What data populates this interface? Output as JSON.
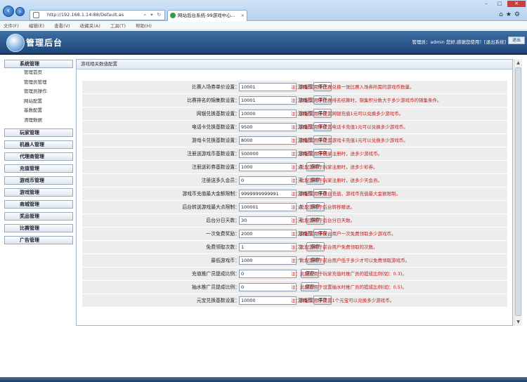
{
  "browser": {
    "url": "http://192.168.1.14:88/Default.as",
    "tab_title": "网站后台系统-99游戏中心...",
    "menu": [
      "文件(F)",
      "编辑(E)",
      "查看(V)",
      "收藏夹(A)",
      "工具(T)",
      "帮助(H)"
    ]
  },
  "header": {
    "title": "管理后台",
    "user_info": "管理员：admin 您好,感谢您使用！[退出系统]",
    "logout_label": "退出"
  },
  "sidebar": {
    "groups": [
      {
        "label": "系统管理",
        "items": [
          "管理首页",
          "管理员管理",
          "管理员操作",
          "网站配置",
          "基数配置",
          "清理数据"
        ]
      },
      {
        "label": "玩家管理",
        "items": []
      },
      {
        "label": "机器人管理",
        "items": []
      },
      {
        "label": "代理商管理",
        "items": []
      },
      {
        "label": "充值管理",
        "items": []
      },
      {
        "label": "游戏币管理",
        "items": []
      },
      {
        "label": "游戏管理",
        "items": []
      },
      {
        "label": "商城管理",
        "items": []
      },
      {
        "label": "奖品管理",
        "items": []
      },
      {
        "label": "比赛管理",
        "items": []
      },
      {
        "label": "广告管理",
        "items": []
      }
    ]
  },
  "panel": {
    "title": "游戏相关数值配置",
    "save_label": "保存",
    "rows": [
      {
        "label": "比赛入场券单价设置：",
        "value": "10001",
        "unit": "游戏币",
        "note": "注：此配置用于比赛兑换一张比赛入场券所需的游戏币数量。"
      },
      {
        "label": "比赛排名的锦集数设置：",
        "value": "10001",
        "unit": "游戏币",
        "note": "注：此配置用于比赛排名结算时，锦集积分数大于多少游戏币的锦集条件。"
      },
      {
        "label": "网银兑换基数设置：",
        "value": "10000",
        "unit": "游戏币",
        "note": "注：此配置用于设置网银充值1元可以兑换多少游戏币。"
      },
      {
        "label": "电话卡兑换基数设置：",
        "value": "9500",
        "unit": "游戏币",
        "note": "注：此配置用于设置电话卡充值1元可以兑换多少游戏币。"
      },
      {
        "label": "游戏卡兑换基数设置：",
        "value": "8000",
        "unit": "游戏币",
        "note": "注：此配置用于设置游戏卡充值1元可以兑换多少游戏币。"
      },
      {
        "label": "注册送游戏币基数设置：",
        "value": "500000",
        "unit": "游戏币",
        "note": "注：此配置用于玩家注册时，送多少游戏币。"
      },
      {
        "label": "注册送彩券基数设置：",
        "value": "1000",
        "unit": "点",
        "note": "注：此配置用于玩家注册时，送多少彩券。"
      },
      {
        "label": "注册送多久会员：",
        "value": "0",
        "unit": "天",
        "note": "注：此配置用于玩家注册时，送多少天会员。"
      },
      {
        "label": "游戏币充值最大金额限制：",
        "value": "9999999999991",
        "unit": "游戏币",
        "note": "注：此配置用于后台充值，游戏币充值最大金额限制。"
      },
      {
        "label": "后台转送游戏最大点限制：",
        "value": "100001",
        "unit": "点",
        "note": "注：此配置用于后台转移赠送。"
      },
      {
        "label": "后台分日天数：",
        "value": "30",
        "unit": "天",
        "note": "注：此配置用于后台分日天数。"
      },
      {
        "label": "一次免费奖励：",
        "value": "2000",
        "unit": "游戏币",
        "note": "注：此配置用于前台用户一次免费领取多少游戏币。"
      },
      {
        "label": "免费领取次数：",
        "value": "1",
        "unit": "次",
        "note": "注：此配置用于前台用户免费领取的次数。"
      },
      {
        "label": "最低游戏币：",
        "value": "1000",
        "unit": "个",
        "note": "注：此配置用于前台用户低于多少才可以免费领取游戏币。"
      },
      {
        "label": "充值推广员提成比例：",
        "value": "0",
        "unit": "",
        "note": "注：此配置用于玩家充值时推广员的提成比例(如：0.3)。"
      },
      {
        "label": "抽水推广员提成比例：",
        "value": "0",
        "unit": "",
        "note": "注：此配置用于设置抽水时推广员的提成比例(如：0.5)。"
      },
      {
        "label": "元宝兑换基数设置：",
        "value": "10000",
        "unit": "游戏币",
        "note": "注：此配置用于设置1个元宝可以兑换多少游戏币。"
      }
    ]
  }
}
